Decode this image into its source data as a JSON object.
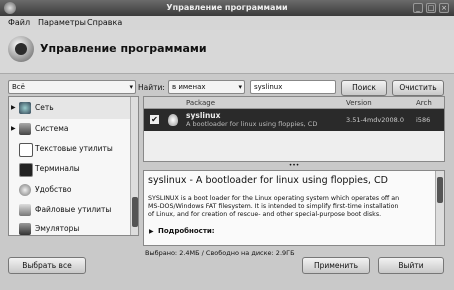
{
  "window": {
    "title": "Управление программами"
  },
  "menu": {
    "file": "Файл",
    "params": "Параметры",
    "help": "Справка"
  },
  "header": {
    "title": "Управление программами"
  },
  "filter": {
    "category": "Всё",
    "find_label": "Найти:",
    "find_scope": "в именах",
    "query": "syslinux",
    "search_btn": "Поиск",
    "clear_btn": "Очистить"
  },
  "categories": [
    {
      "label": "Сеть",
      "expandable": true
    },
    {
      "label": "Система",
      "expandable": true
    },
    {
      "label": "Текстовые утилиты",
      "expandable": false
    },
    {
      "label": "Терминалы",
      "expandable": false
    },
    {
      "label": "Удобство",
      "expandable": false
    },
    {
      "label": "Файловые утилиты",
      "expandable": false
    },
    {
      "label": "Эмуляторы",
      "expandable": false
    }
  ],
  "table": {
    "col_package": "Package",
    "col_version": "Version",
    "col_arch": "Arch",
    "rows": [
      {
        "name": "syslinux",
        "desc": "A bootloader for linux using floppies, CD",
        "version": "3.51-4mdv2008.0",
        "arch": "i586",
        "checked": true
      }
    ]
  },
  "details": {
    "heading": "syslinux - A bootloader for linux using floppies, CD",
    "body_line1": "SYSLINUX is a boot loader for the Linux operating system which operates off an",
    "body_line2": "MS-DOS/Windows FAT filesystem.  It is intended to simplify first-time installation",
    "body_line3": "of Linux, and for creation of rescue- and other special-purpose boot disks.",
    "more": "Подробности:"
  },
  "footer": {
    "select_all": "Выбрать все",
    "status": "Выбрано: 2.4МБ / Свободно на диске: 2.9ГБ",
    "apply": "Применить",
    "quit": "Выйти"
  }
}
